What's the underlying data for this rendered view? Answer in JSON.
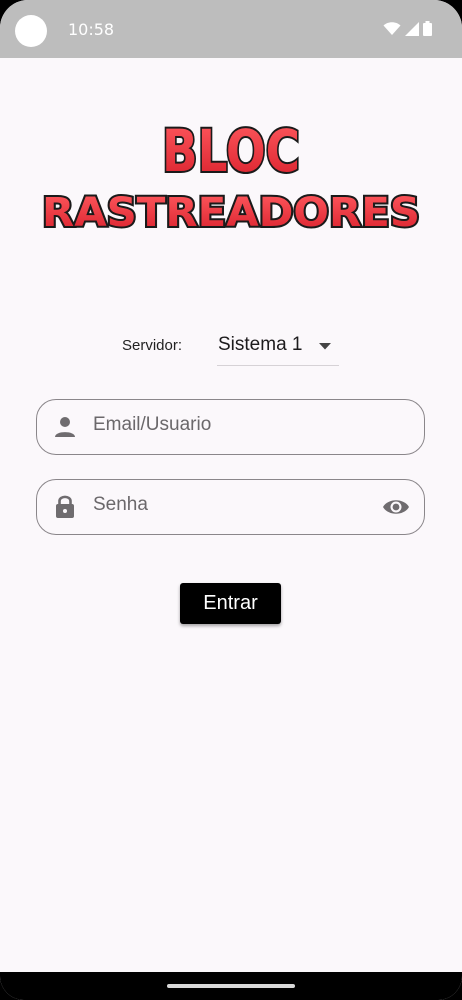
{
  "status_bar": {
    "time": "10:58",
    "icons": [
      "wifi-icon",
      "signal-icon",
      "battery-icon"
    ]
  },
  "logo": {
    "line1": "BLOC",
    "line2": "RASTREADORES",
    "fill_color": "#e8323b",
    "outline_color": "#1a1a1a"
  },
  "server": {
    "label": "Servidor:",
    "selected": "Sistema 1"
  },
  "login_form": {
    "email_placeholder": "Email/Usuario",
    "password_placeholder": "Senha",
    "submit_label": "Entrar"
  },
  "colors": {
    "background": "#fbf8fb",
    "button": "#000000",
    "field_border": "#8a868a"
  }
}
